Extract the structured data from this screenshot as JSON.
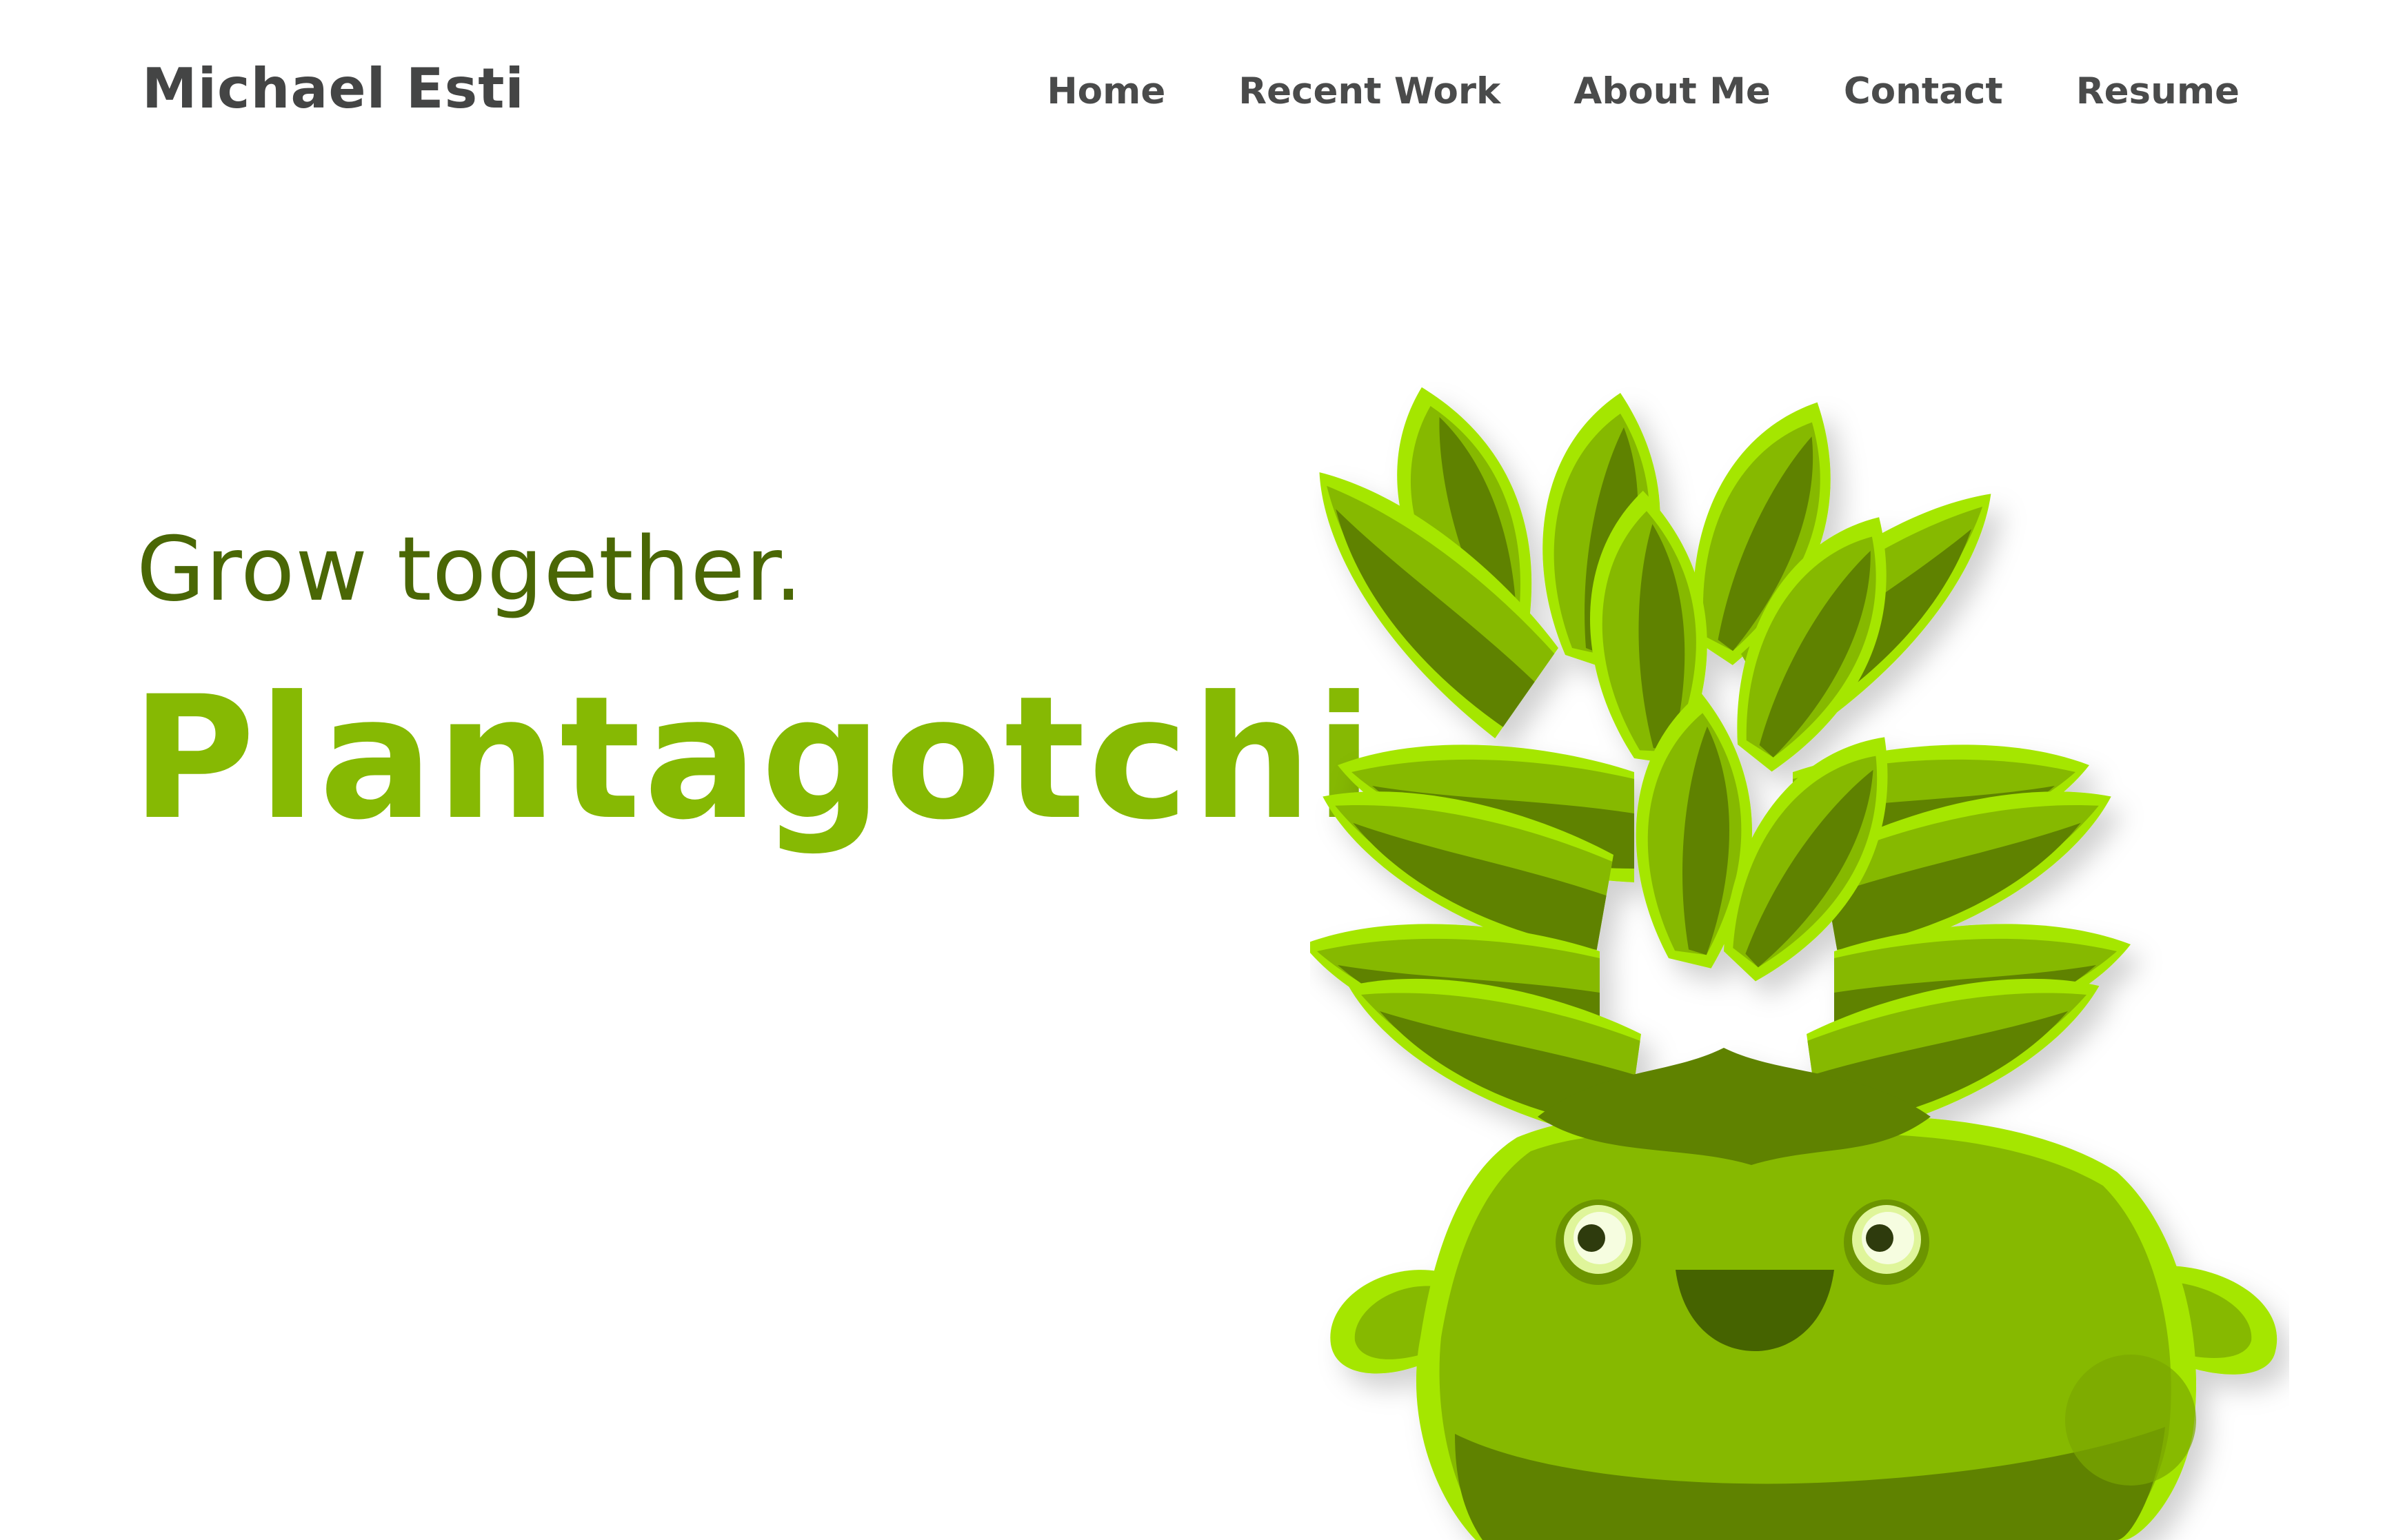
{
  "header": {
    "brand": "Michael Esti",
    "nav": [
      {
        "label": "Home"
      },
      {
        "label": "Recent Work"
      },
      {
        "label": "About Me"
      },
      {
        "label": "Contact"
      },
      {
        "label": "Resume"
      }
    ]
  },
  "hero": {
    "subtitle": "Grow together.",
    "title": "Plantagotchi",
    "illustration": "plant-mascot-illustration"
  },
  "colors": {
    "brand_text": "#444545",
    "nav_text": "#4a4b4b",
    "subtitle": "#4a6705",
    "title": "#86b903",
    "leaf_light": "#a5e600",
    "leaf_mid": "#86b903",
    "leaf_dark": "#5e8200",
    "background": "#ffffff"
  }
}
